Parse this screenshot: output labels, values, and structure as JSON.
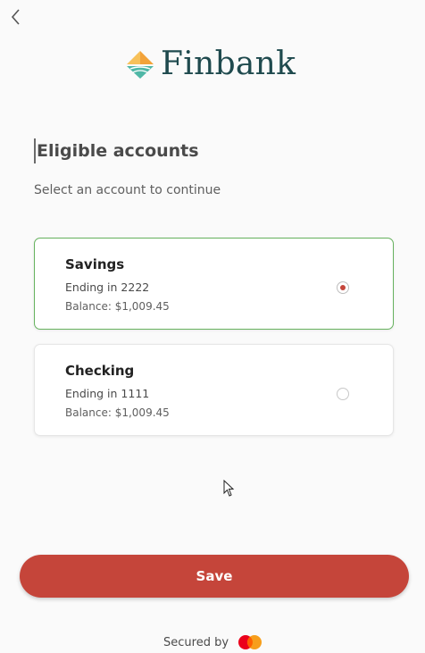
{
  "brand": {
    "name": "Finbank",
    "logo_icon": "finbank-logo-icon"
  },
  "header": {
    "back_icon": "chevron-left-icon"
  },
  "page": {
    "title": "Eligible accounts",
    "subtitle": "Select an account to continue"
  },
  "accounts": [
    {
      "name": "Savings",
      "ending": "Ending in 2222",
      "balance": "Balance: $1,009.45",
      "selected": true
    },
    {
      "name": "Checking",
      "ending": "Ending in 1111",
      "balance": "Balance: $1,009.45",
      "selected": false
    }
  ],
  "actions": {
    "save_label": "Save"
  },
  "footer": {
    "secured_label": "Secured by",
    "logo_icon": "mastercard-logo-icon"
  },
  "colors": {
    "accent": "#c5453a",
    "selected_border": "#66b25e",
    "brand_text": "#1f4a4e",
    "logo_orange": "#f2a33a",
    "logo_teal": "#4fb7a6"
  }
}
